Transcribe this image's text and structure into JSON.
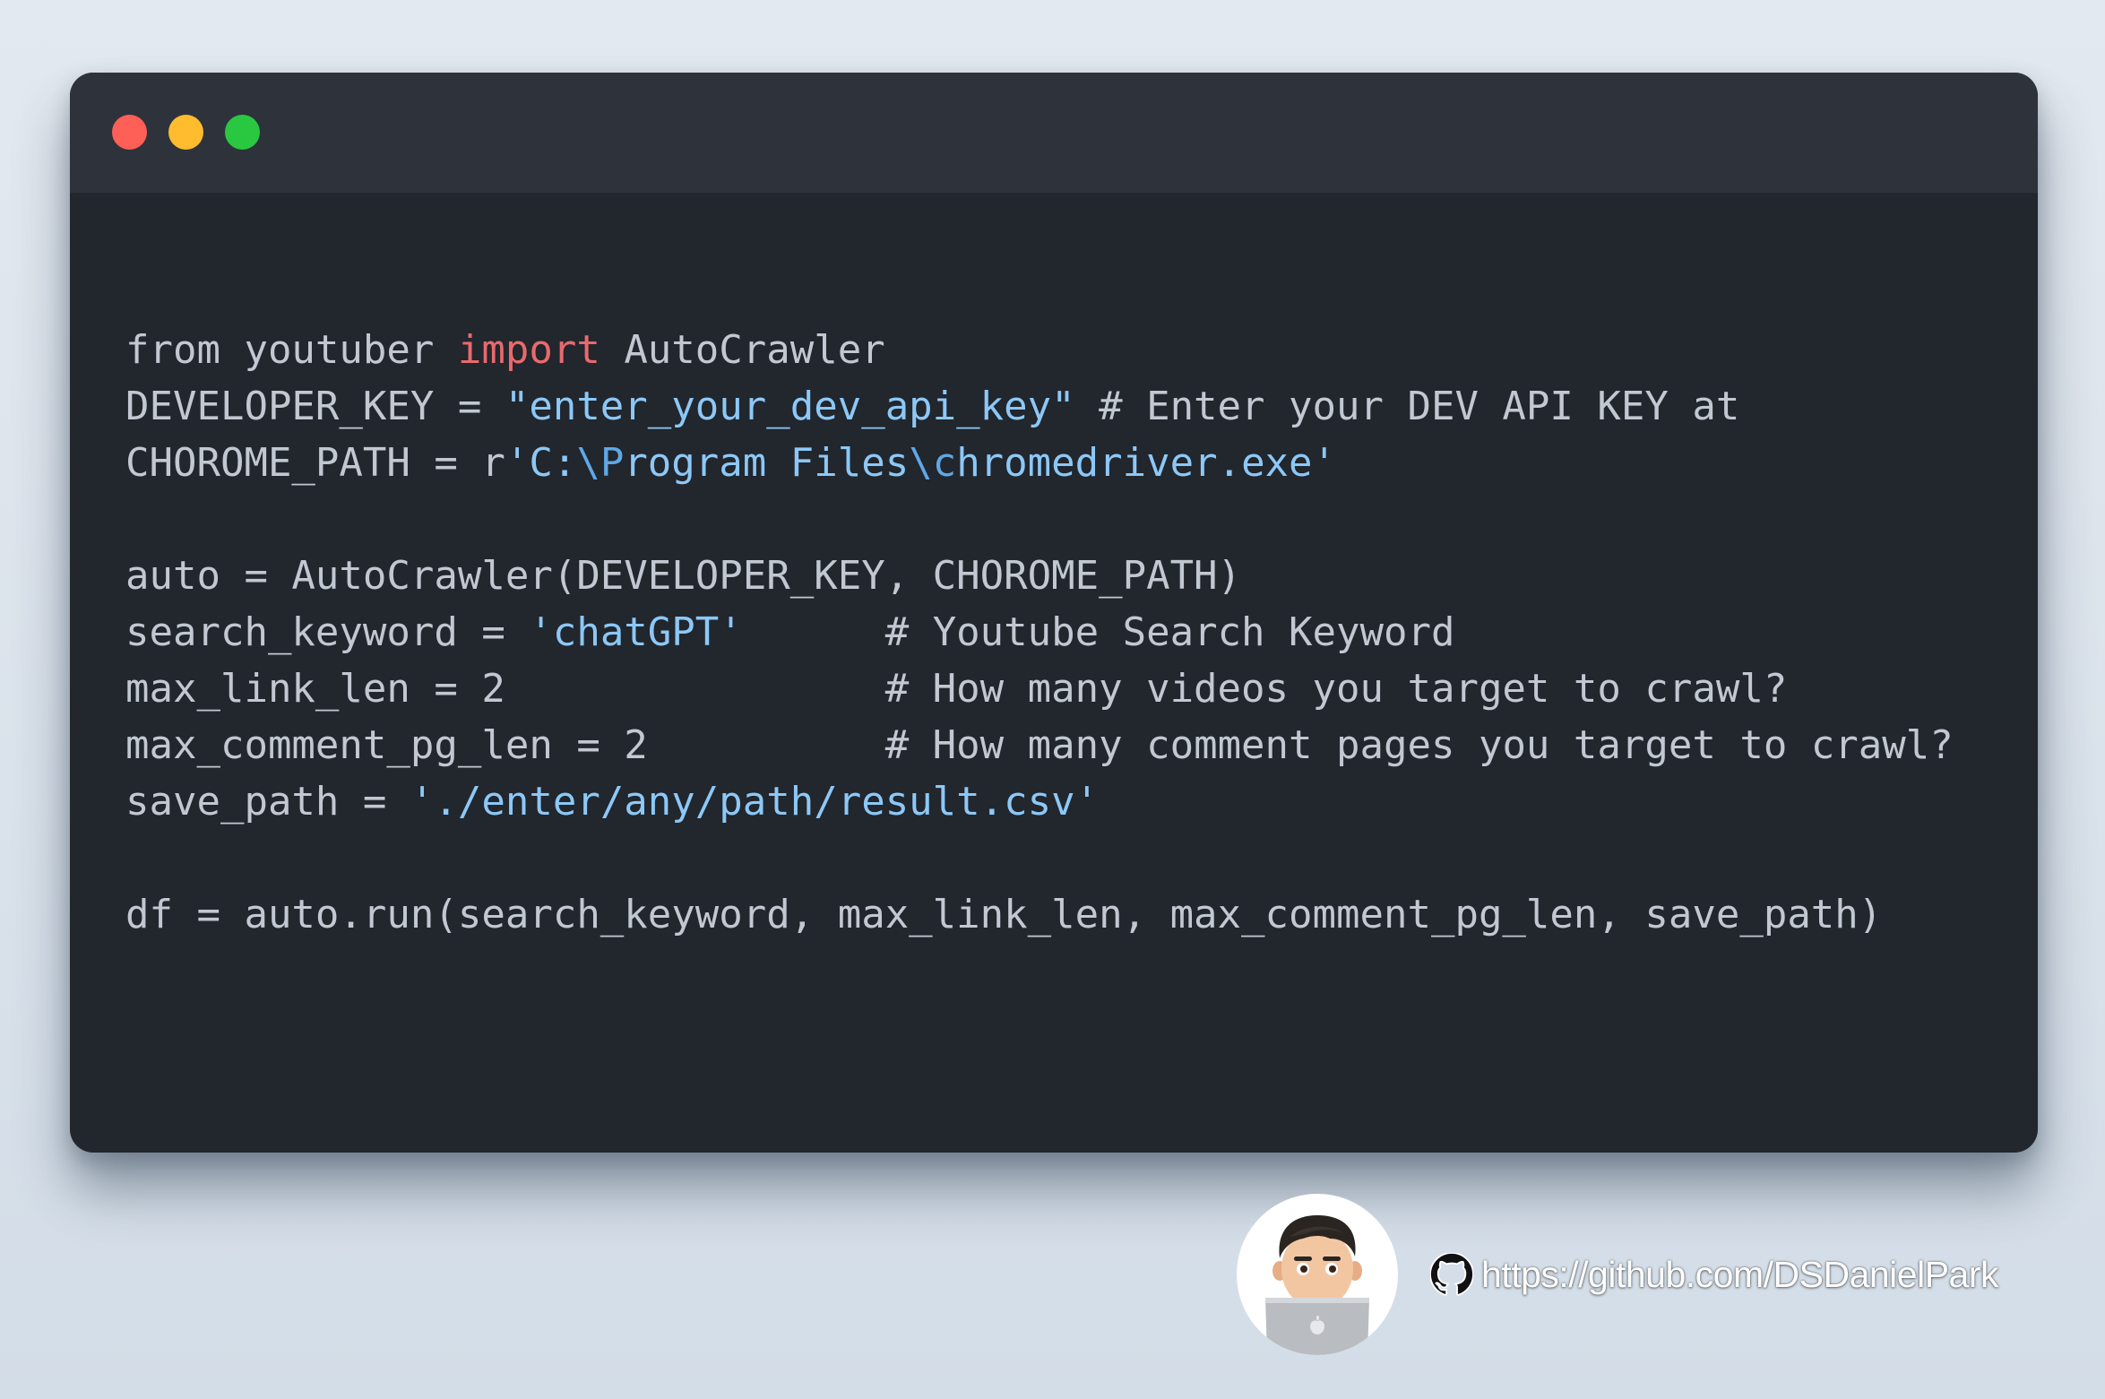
{
  "window": {
    "controls": [
      {
        "name": "close",
        "color": "#fe5f57"
      },
      {
        "name": "minimize",
        "color": "#febc2e"
      },
      {
        "name": "maximize",
        "color": "#29c840"
      }
    ]
  },
  "code": {
    "lines": [
      {
        "tokens": [
          {
            "text": "from youtuber ",
            "kind": "plain"
          },
          {
            "text": "import",
            "kind": "kw"
          },
          {
            "text": " AutoCrawler",
            "kind": "plain"
          }
        ]
      },
      {
        "tokens": [
          {
            "text": "DEVELOPER_KEY = ",
            "kind": "plain"
          },
          {
            "text": "\"enter_your_dev_api_key\"",
            "kind": "str"
          },
          {
            "text": " # Enter your DEV API KEY at",
            "kind": "cmt"
          }
        ]
      },
      {
        "tokens": [
          {
            "text": "CHOROME_PATH = r",
            "kind": "plain"
          },
          {
            "text": "'C:",
            "kind": "str"
          },
          {
            "text": "\\P",
            "kind": "esc"
          },
          {
            "text": "rogram Files",
            "kind": "str"
          },
          {
            "text": "\\c",
            "kind": "esc"
          },
          {
            "text": "hromedriver.exe'",
            "kind": "str"
          }
        ]
      },
      {
        "tokens": []
      },
      {
        "tokens": [
          {
            "text": "auto = AutoCrawler(DEVELOPER_KEY, CHOROME_PATH)",
            "kind": "plain"
          }
        ]
      },
      {
        "tokens": [
          {
            "text": "search_keyword = ",
            "kind": "plain"
          },
          {
            "text": "'chatGPT'",
            "kind": "str"
          },
          {
            "text": "      # Youtube Search Keyword",
            "kind": "cmt"
          }
        ]
      },
      {
        "tokens": [
          {
            "text": "max_link_len = 2",
            "kind": "plain"
          },
          {
            "text": "                # How many videos you target to crawl?",
            "kind": "cmt"
          }
        ]
      },
      {
        "tokens": [
          {
            "text": "max_comment_pg_len = 2",
            "kind": "plain"
          },
          {
            "text": "          # How many comment pages you target to crawl?",
            "kind": "cmt"
          }
        ]
      },
      {
        "tokens": [
          {
            "text": "save_path = ",
            "kind": "plain"
          },
          {
            "text": "'./enter/any/path/result.csv'",
            "kind": "str"
          }
        ]
      },
      {
        "tokens": []
      },
      {
        "tokens": [
          {
            "text": "df = auto.run(search_keyword, max_link_len, max_comment_pg_len, save_path)",
            "kind": "plain"
          }
        ]
      }
    ]
  },
  "footer": {
    "avatar_icon": "memoji-avatar-icon",
    "github_icon": "github-icon",
    "link_text": "https://github.com/DSDanielPark"
  },
  "colors": {
    "background": "#dfe6ee",
    "editor_bg": "#22262d",
    "titlebar_bg": "#2e323b",
    "code_text": "#c2c8d1",
    "keyword": "#e86a6d",
    "string": "#8cc8f7",
    "escape": "#5fa8e6"
  }
}
